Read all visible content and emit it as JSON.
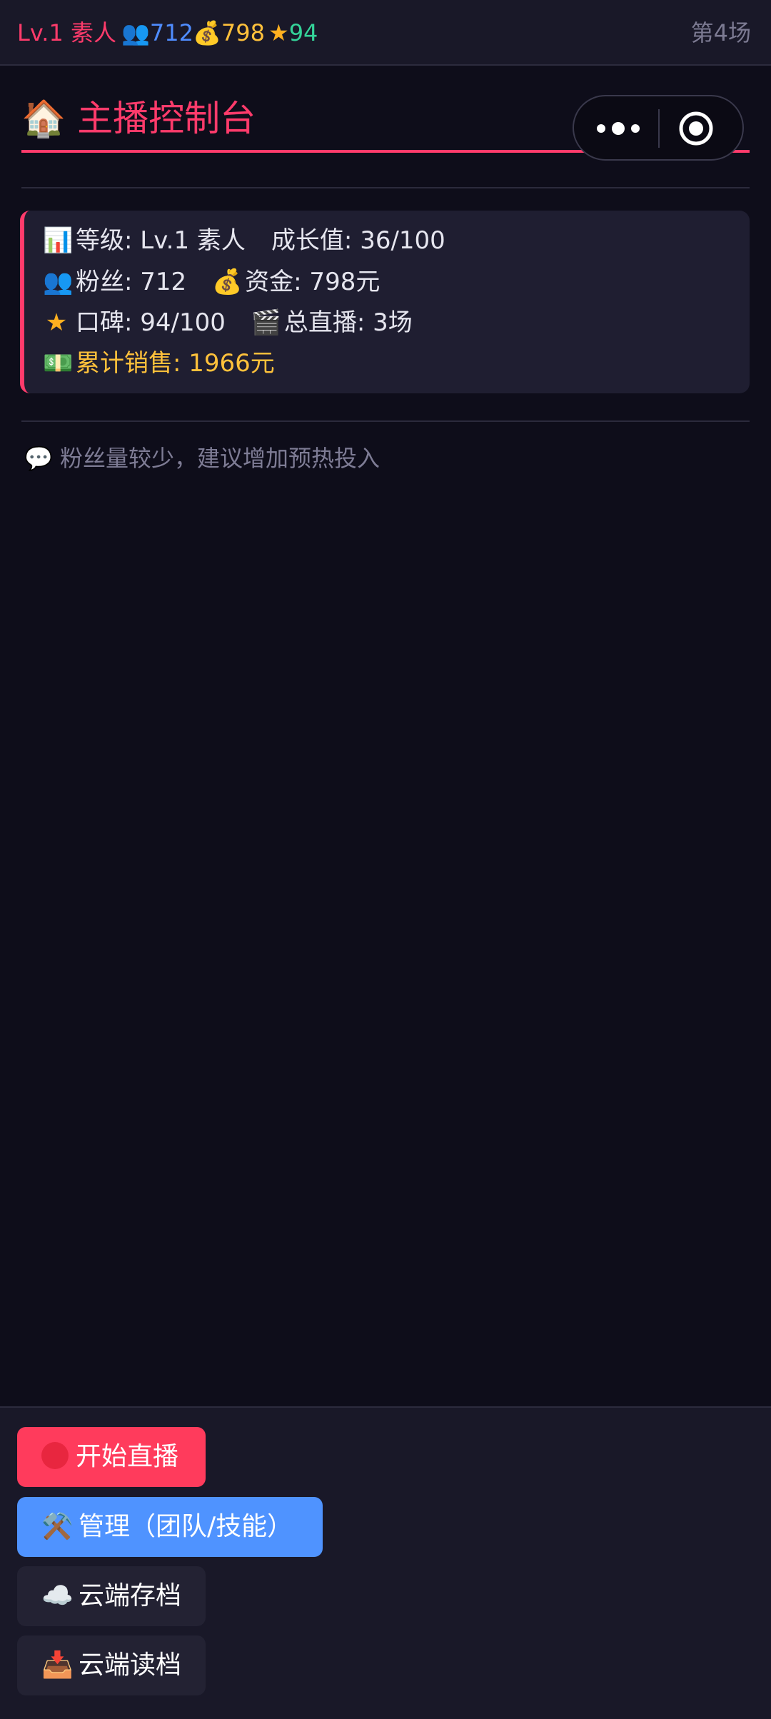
{
  "status_bar": {
    "level": "Lv.1 素人",
    "fans": "712",
    "money": "798",
    "reputation": "94",
    "round": "第4场"
  },
  "header": {
    "title": "主播控制台",
    "title_icon": "house-icon"
  },
  "stats_card": {
    "level": "等级: Lv.1 素人",
    "growth": "成长值: 36/100",
    "fans": "粉丝: 712",
    "money": "资金: 798元",
    "reputation": "口碑: 94/100",
    "total_streams": "总直播: 3场",
    "total_sales": "累计销售: 1966元"
  },
  "tip": {
    "text": "粉丝量较少，建议增加预热投入"
  },
  "actions": {
    "start_live": "开始直播",
    "manage": "管理（团队/技能）",
    "cloud_save": "云端存档",
    "cloud_load": "云端读档"
  },
  "colors": {
    "accent": "#ff3b6b",
    "fans": "#4f8cff",
    "money": "#ffc13b",
    "reputation": "#34d399",
    "manage_button": "#4f93ff",
    "background": "#0e0d1a"
  }
}
